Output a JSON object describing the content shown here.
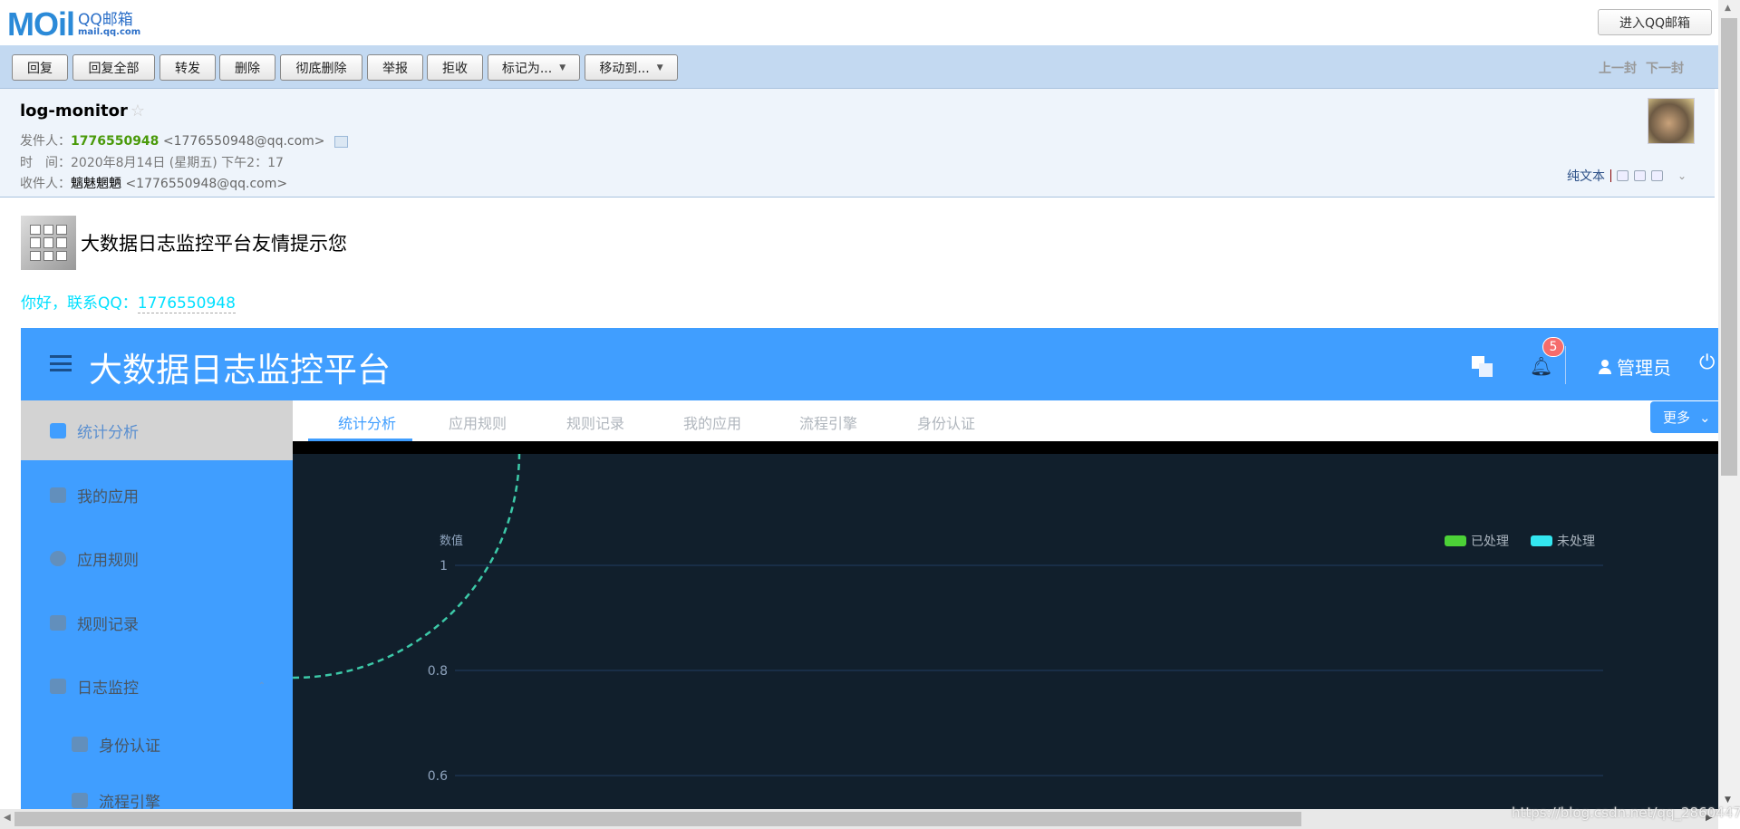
{
  "logo": {
    "big": "MOil",
    "name": "QQ邮箱",
    "domain": "mail.qq.com"
  },
  "enter_button": "进入QQ邮箱",
  "toolbar": {
    "buttons": [
      "回复",
      "回复全部",
      "转发",
      "删除",
      "彻底删除",
      "举报",
      "拒收"
    ],
    "mark_as": "标记为...",
    "move_to": "移动到...",
    "prev": "上一封",
    "next": "下一封"
  },
  "mail": {
    "subject": "log-monitor",
    "star": "☆",
    "from_label": "发件人：",
    "from_name": "1776550948",
    "from_addr": "<1776550948@qq.com>",
    "time_label": "时　间：",
    "time": "2020年8月14日 (星期五) 下午2：17",
    "to_label": "收件人：",
    "to_name": "魑魅魍魉",
    "to_addr": "<1776550948@qq.com>",
    "plain_text": "纯文本",
    "body_title": "大数据日志监控平台友情提示您",
    "hello": "你好，联系QQ：",
    "hello_qq": "1776550948"
  },
  "embedded": {
    "title": "大数据日志监控平台",
    "badge": "5",
    "user": "管理员",
    "sidebar": [
      {
        "label": "统计分析",
        "icon": "chart-icon",
        "active": true
      },
      {
        "label": "我的应用",
        "icon": "grid-icon"
      },
      {
        "label": "应用规则",
        "icon": "gear-icon"
      },
      {
        "label": "规则记录",
        "icon": "record-icon"
      },
      {
        "label": "日志监控",
        "icon": "monitor-icon"
      },
      {
        "label": "身份认证",
        "icon": "home-icon"
      },
      {
        "label": "流程引擎",
        "icon": "home-icon"
      }
    ],
    "tabs": [
      "统计分析",
      "应用规则",
      "规则记录",
      "我的应用",
      "流程引擎",
      "身份认证"
    ],
    "more": "更多"
  },
  "chart_data": {
    "type": "line",
    "ylabel": "数值",
    "yticks": [
      1,
      0.8,
      0.6
    ],
    "grid": true,
    "legend_position": "top-right",
    "series": [
      {
        "name": "已处理",
        "color": "#4cd137"
      },
      {
        "name": "未处理",
        "color": "#33e6f0"
      }
    ],
    "decoration_color": "#3cc9a8"
  },
  "watermark": "https://blog.csdn.net/qq_28604473",
  "colors": {
    "toolbar": "#c3d9f1",
    "header": "#eef4fb",
    "brand": "#409eff",
    "chart_bg": "#111f2c"
  }
}
